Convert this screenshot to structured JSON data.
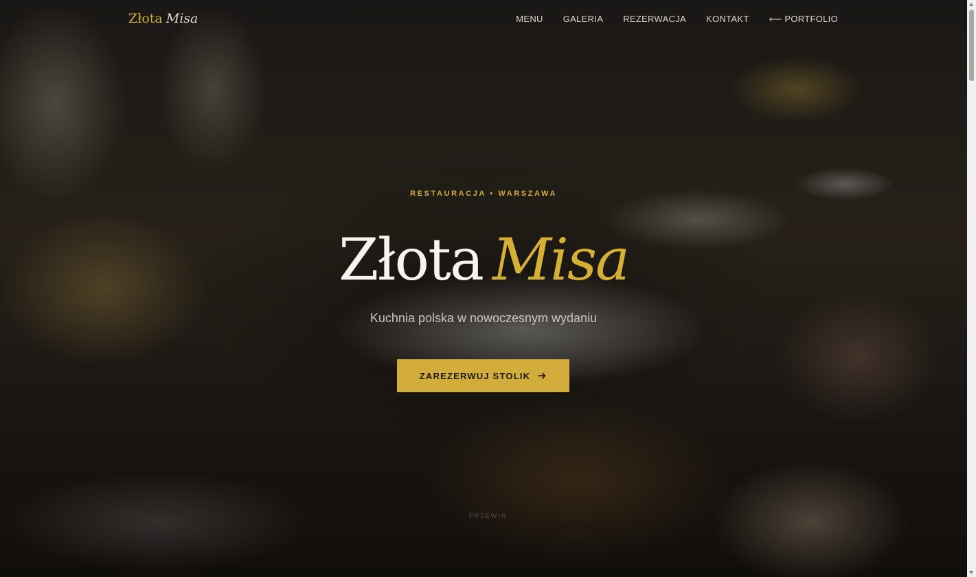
{
  "brand": {
    "name_first": "Złota",
    "name_second": "Misa"
  },
  "nav": {
    "items": [
      {
        "label": "MENU"
      },
      {
        "label": "GALERIA"
      },
      {
        "label": "REZERWACJA"
      },
      {
        "label": "KONTAKT"
      },
      {
        "label": "⟵ PORTFOLIO"
      }
    ]
  },
  "hero": {
    "eyebrow": "RESTAURACJA • WARSZAWA",
    "title_first": "Złota",
    "title_second": "Misa",
    "subtitle": "Kuchnia polska w nowoczesnym wydaniu",
    "cta_label": "ZAREZERWUJ STOLIK",
    "cta_icon": "arrow-right-icon",
    "scroll_hint": "PRZEWIŃ"
  },
  "colors": {
    "accent": "#d2ad3b",
    "text_light": "#f6f4ef",
    "button_text": "#1a1712"
  }
}
